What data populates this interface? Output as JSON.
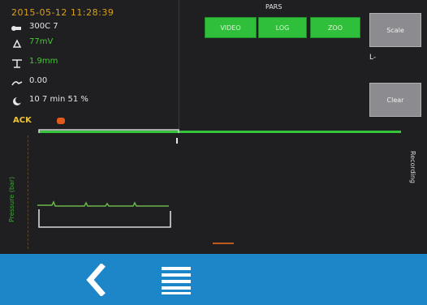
{
  "status": {
    "timestamp": "2015-05-12 11:28:39",
    "rows": [
      {
        "icon": "thermometer-icon",
        "value": "300C 7",
        "color": "white"
      },
      {
        "icon": "probe-icon",
        "value": "77mV",
        "color": "green"
      },
      {
        "icon": "scale-icon",
        "value": "1.9mm",
        "color": "green"
      },
      {
        "icon": "flow-icon",
        "value": "0.00",
        "color": "white"
      },
      {
        "icon": "moon-icon",
        "value": "10 7 min 51 %",
        "color": "white"
      }
    ],
    "ack_label": "ACK"
  },
  "segment": {
    "label": "PARS",
    "buttons": [
      "VIDEO",
      "LOG",
      "ZOO"
    ]
  },
  "side": {
    "top_label": "Scale",
    "mid_label": "L-",
    "bottom_label": "Clear"
  },
  "plot": {
    "y_axis_label": "Pressure (bar)",
    "right_axis_label": "Recording"
  },
  "nav": {
    "back_icon": "chevron-left-icon",
    "menu_icon": "menu-icon"
  },
  "colors": {
    "accent_green": "#35c53b",
    "warning_yellow": "#f1c232",
    "nav_blue": "#1d86c9"
  }
}
